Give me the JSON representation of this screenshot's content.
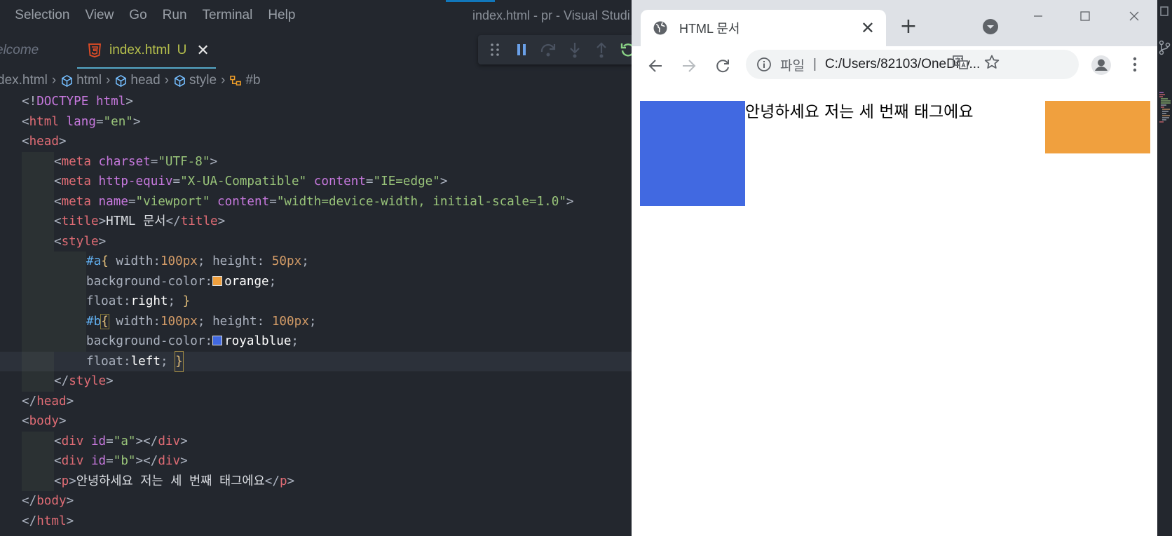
{
  "vscode": {
    "menu": [
      "t",
      "Selection",
      "View",
      "Go",
      "Run",
      "Terminal",
      "Help"
    ],
    "window_title": "index.html - pr - Visual Studi",
    "tabs": {
      "welcome": "elcome",
      "index": "index.html",
      "index_badge": "U",
      "close": "✕"
    },
    "breadcrumb": [
      "dex.html",
      "html",
      "head",
      "style",
      "#b"
    ],
    "colors": {
      "orange": "#f0a03e",
      "royalblue": "#4169e1"
    }
  },
  "code": {
    "l1": {
      "a": "<!",
      "b": "DOCTYPE",
      "c": " ",
      "d": "html",
      "e": ">"
    },
    "l2": {
      "a": "<",
      "b": "html",
      "c": " lang",
      "d": "=",
      "e": "\"en\"",
      "f": ">"
    },
    "l3": {
      "a": "<",
      "b": "head",
      "c": ">"
    },
    "l4": {
      "a": "<",
      "b": "meta",
      "c": " charset",
      "d": "=",
      "e": "\"UTF-8\"",
      "f": ">"
    },
    "l5": {
      "a": "<",
      "b": "meta",
      "c": " http-equiv",
      "d": "=",
      "e": "\"X-UA-Compatible\"",
      "f": " content",
      "g": "=",
      "h": "\"IE=edge\"",
      "i": ">"
    },
    "l6": {
      "a": "<",
      "b": "meta",
      "c": " name",
      "d": "=",
      "e": "\"viewport\"",
      "f": " content",
      "g": "=",
      "h": "\"width=device-width, initial-scale=1.0\"",
      "i": ">"
    },
    "l7": {
      "a": "<",
      "b": "title",
      "c": ">",
      "d": "HTML 문서",
      "e": "</",
      "f": "title",
      "g": ">"
    },
    "l8": {
      "a": "<",
      "b": "style",
      "c": ">"
    },
    "l9": {
      "a": "#a",
      "b": "{",
      "c": " width:",
      "d": "100px",
      "e": "; height: ",
      "f": "50px",
      "g": ";"
    },
    "l10": {
      "a": "background-color:",
      "b": "orange",
      "c": ";"
    },
    "l11": {
      "a": "float:",
      "b": "right",
      "c": "; ",
      "d": "}"
    },
    "l12": {
      "a": "#b",
      "b": "{",
      "c": " width:",
      "d": "100px",
      "e": "; height: ",
      "f": "100px",
      "g": ";"
    },
    "l13": {
      "a": "background-color:",
      "b": "royalblue",
      "c": ";"
    },
    "l14": {
      "a": "float:",
      "b": "left",
      "c": "; ",
      "d": "}"
    },
    "l15": {
      "a": "</",
      "b": "style",
      "c": ">"
    },
    "l16": {
      "a": "</",
      "b": "head",
      "c": ">"
    },
    "l17": {
      "a": "<",
      "b": "body",
      "c": ">"
    },
    "l18": {
      "a": "<",
      "b": "div",
      "c": " id",
      "d": "=",
      "e": "\"a\"",
      "f": "></",
      "g": "div",
      "h": ">"
    },
    "l19": {
      "a": "<",
      "b": "div",
      "c": " id",
      "d": "=",
      "e": "\"b\"",
      "f": "></",
      "g": "div",
      "h": ">"
    },
    "l20": {
      "a": "<",
      "b": "p",
      "c": ">",
      "d": "안녕하세요 저는 세 번째 태그에요",
      "e": "</",
      "f": "p",
      "g": ">"
    },
    "l21": {
      "a": "</",
      "b": "body",
      "c": ">"
    },
    "l22": {
      "a": "</",
      "b": "html",
      "c": ">"
    }
  },
  "browser": {
    "tab_title": "HTML 문서",
    "tab_close": "✕",
    "new_tab": "+",
    "omnibox": {
      "scheme": "파일",
      "separator": "|",
      "url": "C:/Users/82103/OneDriv..."
    },
    "page_text": "안녕하세요 저는 세 번째 태그에요",
    "box_colors": {
      "a": "#f0a03e",
      "b": "#4169e1"
    }
  }
}
